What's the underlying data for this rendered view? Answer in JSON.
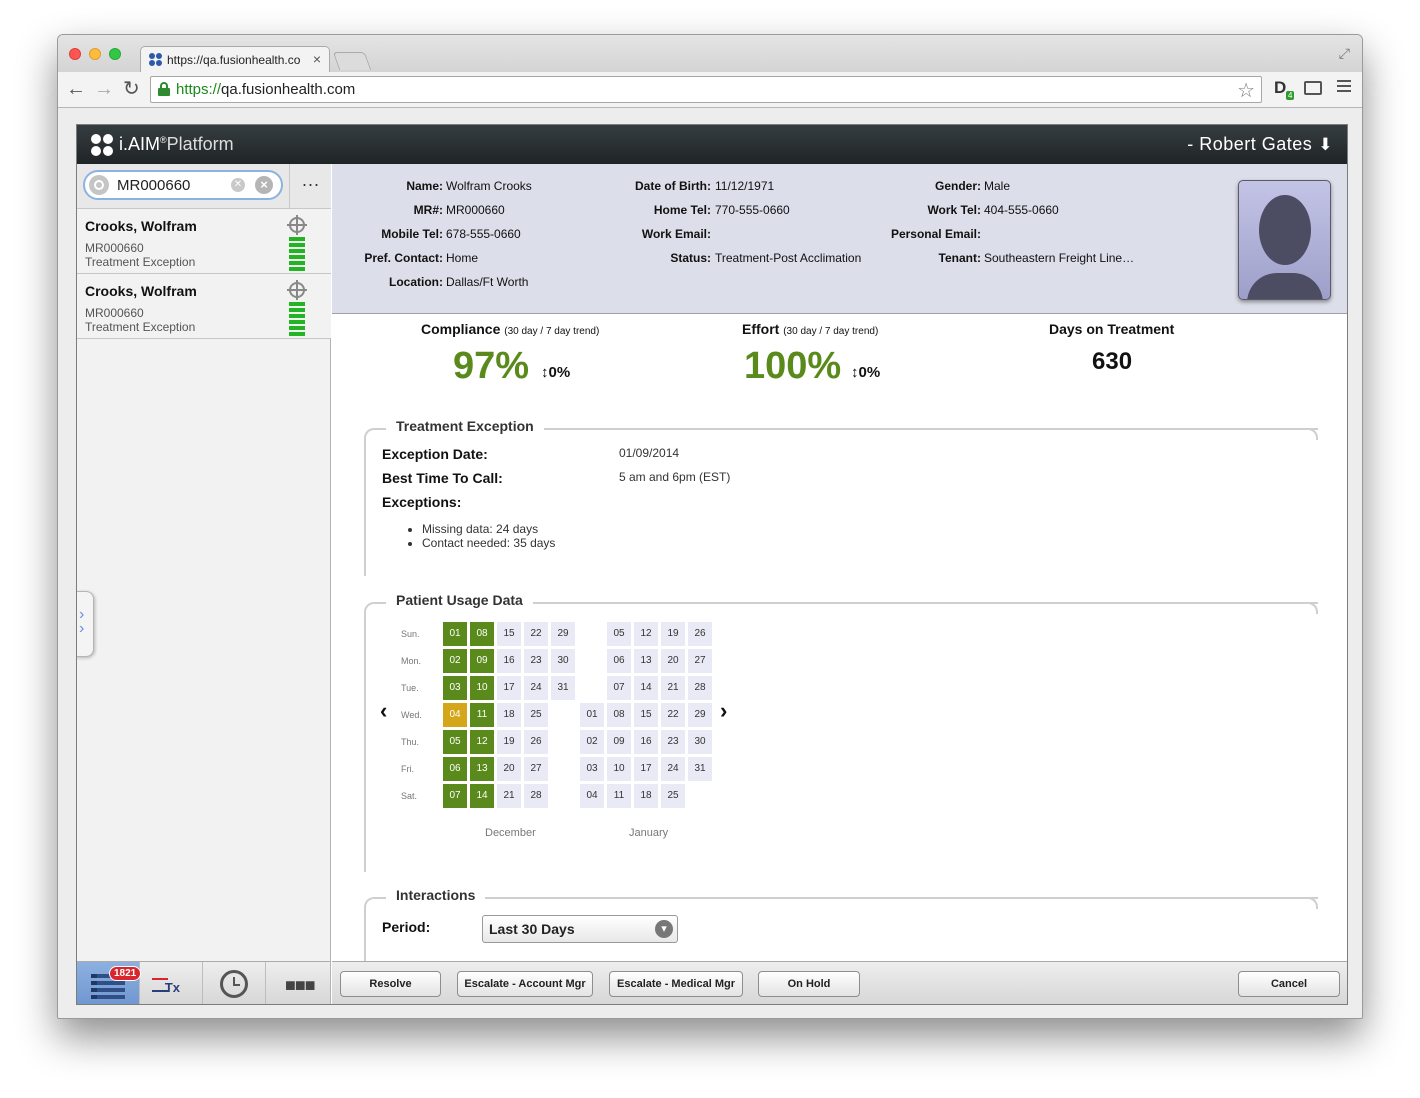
{
  "browser": {
    "tab_title": "https://qa.fusionhealth.co",
    "tab_close": "×",
    "url_scheme": "https://",
    "url_host": "qa.fusionhealth.com",
    "extension_badge": "4",
    "icons": [
      "back-icon",
      "forward-icon",
      "reload-icon",
      "lock-icon",
      "star-icon",
      "cast-icon",
      "menu-icon"
    ]
  },
  "app": {
    "logo_name": "i.AIM",
    "logo_reg": "®",
    "logo_sub": "Platform",
    "user_name": "- Robert Gates",
    "user_arrow": "🡇"
  },
  "search": {
    "value": "MR000660",
    "more_label": "···"
  },
  "patients": [
    {
      "name": "Crooks, Wolfram",
      "mr": "MR000660",
      "status": "Treatment Exception"
    },
    {
      "name": "Crooks, Wolfram",
      "mr": "MR000660",
      "status": "Treatment Exception"
    }
  ],
  "left_nav": {
    "badge": "1821",
    "rx_label": "Tx",
    "more_label": "■■■"
  },
  "patient": {
    "name_label": "Name:",
    "name": "Wolfram Crooks",
    "dob_label": "Date of Birth:",
    "dob": "11/12/1971",
    "gender_label": "Gender:",
    "gender": "Male",
    "mr_label": "MR#:",
    "mr": "MR000660",
    "home_tel_label": "Home Tel:",
    "home_tel": "770-555-0660",
    "work_tel_label": "Work Tel:",
    "work_tel": "404-555-0660",
    "mobile_tel_label": "Mobile Tel:",
    "mobile_tel": "678-555-0660",
    "work_email_label": "Work Email:",
    "work_email": "",
    "personal_email_label": "Personal Email:",
    "personal_email": "",
    "pref_contact_label": "Pref. Contact:",
    "pref_contact": "Home",
    "status_label": "Status:",
    "status": "Treatment-Post Acclimation",
    "tenant_label": "Tenant:",
    "tenant": "Southeastern Freight Line…",
    "location_label": "Location:",
    "location": "Dallas/Ft Worth"
  },
  "metrics": {
    "compliance_label": "Compliance",
    "compliance_sub": "(30 day / 7 day trend)",
    "compliance_value": "97%",
    "compliance_trend": "↕0%",
    "effort_label": "Effort",
    "effort_sub": "(30 day / 7 day trend)",
    "effort_value": "100%",
    "effort_trend": "↕0%",
    "days_label": "Days on Treatment",
    "days_value": "630",
    "value_color": "#5a8a1c"
  },
  "exception": {
    "title": "Treatment Exception",
    "date_label": "Exception Date:",
    "date": "01/09/2014",
    "call_label": "Best Time To Call:",
    "call": "5 am and 6pm (EST)",
    "exceptions_label": "Exceptions:",
    "items": [
      "Missing data: 24 days",
      "Contact needed: 35 days"
    ]
  },
  "usage": {
    "title": "Patient Usage Data",
    "day_labels": [
      "Sun.",
      "Mon.",
      "Tue.",
      "Wed.",
      "Thu.",
      "Fri.",
      "Sat."
    ],
    "months": [
      "December",
      "January"
    ],
    "prev_label": "‹",
    "next_label": "›",
    "december": [
      [
        {
          "d": "01",
          "s": "good"
        },
        {
          "d": "08",
          "s": "good"
        },
        {
          "d": "15"
        },
        {
          "d": "22"
        },
        {
          "d": "29"
        }
      ],
      [
        {
          "d": "02",
          "s": "good"
        },
        {
          "d": "09",
          "s": "good"
        },
        {
          "d": "16"
        },
        {
          "d": "23"
        },
        {
          "d": "30"
        }
      ],
      [
        {
          "d": "03",
          "s": "good"
        },
        {
          "d": "10",
          "s": "good"
        },
        {
          "d": "17"
        },
        {
          "d": "24"
        },
        {
          "d": "31"
        }
      ],
      [
        {
          "d": "04",
          "s": "warn"
        },
        {
          "d": "11",
          "s": "good"
        },
        {
          "d": "18"
        },
        {
          "d": "25"
        }
      ],
      [
        {
          "d": "05",
          "s": "good"
        },
        {
          "d": "12",
          "s": "good"
        },
        {
          "d": "19"
        },
        {
          "d": "26"
        }
      ],
      [
        {
          "d": "06",
          "s": "good"
        },
        {
          "d": "13",
          "s": "good"
        },
        {
          "d": "20"
        },
        {
          "d": "27"
        }
      ],
      [
        {
          "d": "07",
          "s": "good"
        },
        {
          "d": "14",
          "s": "good"
        },
        {
          "d": "21"
        },
        {
          "d": "28"
        }
      ]
    ],
    "january": [
      [
        null,
        {
          "d": "05"
        },
        {
          "d": "12"
        },
        {
          "d": "19"
        },
        {
          "d": "26"
        }
      ],
      [
        null,
        {
          "d": "06"
        },
        {
          "d": "13"
        },
        {
          "d": "20"
        },
        {
          "d": "27"
        }
      ],
      [
        null,
        {
          "d": "07"
        },
        {
          "d": "14"
        },
        {
          "d": "21"
        },
        {
          "d": "28"
        }
      ],
      [
        {
          "d": "01"
        },
        {
          "d": "08"
        },
        {
          "d": "15"
        },
        {
          "d": "22"
        },
        {
          "d": "29"
        }
      ],
      [
        {
          "d": "02"
        },
        {
          "d": "09"
        },
        {
          "d": "16"
        },
        {
          "d": "23"
        },
        {
          "d": "30"
        }
      ],
      [
        {
          "d": "03"
        },
        {
          "d": "10"
        },
        {
          "d": "17"
        },
        {
          "d": "24"
        },
        {
          "d": "31"
        }
      ],
      [
        {
          "d": "04"
        },
        {
          "d": "11"
        },
        {
          "d": "18"
        },
        {
          "d": "25"
        }
      ]
    ],
    "colors": {
      "good": "#5a8a1c",
      "warn": "#d4a61a",
      "empty": "#e9eaf5"
    }
  },
  "interactions": {
    "title": "Interactions",
    "period_label": "Period:",
    "period_value": "Last 30 Days"
  },
  "actions": {
    "resolve": "Resolve",
    "escalate_account": "Escalate - Account Mgr",
    "escalate_medical": "Escalate - Medical Mgr",
    "on_hold": "On Hold",
    "cancel": "Cancel"
  }
}
